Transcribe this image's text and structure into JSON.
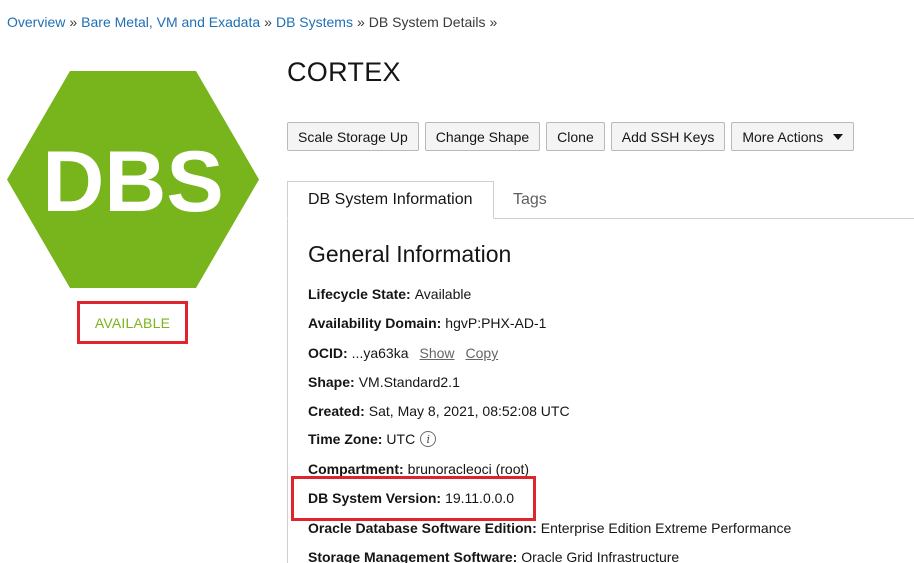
{
  "breadcrumb": {
    "items": [
      "Overview",
      "Bare Metal, VM and Exadata",
      "DB Systems"
    ],
    "current": "DB System Details",
    "separator": "»"
  },
  "badge": {
    "text": "DBS",
    "color": "#78b41c",
    "status": "AVAILABLE",
    "status_color": "#7bb31a"
  },
  "title": "CORTEX",
  "actions": {
    "scale_storage": "Scale Storage Up",
    "change_shape": "Change Shape",
    "clone": "Clone",
    "add_ssh_keys": "Add SSH Keys",
    "more_actions": "More Actions"
  },
  "tabs": {
    "info": "DB System Information",
    "tags": "Tags"
  },
  "general": {
    "heading": "General Information",
    "lifecycle": {
      "label": "Lifecycle State:",
      "value": "Available"
    },
    "availability_domain": {
      "label": "Availability Domain:",
      "value": "hgvP:PHX-AD-1"
    },
    "ocid": {
      "label": "OCID:",
      "value": "...ya63ka",
      "show": "Show",
      "copy": "Copy"
    },
    "shape": {
      "label": "Shape:",
      "value": "VM.Standard2.1"
    },
    "created": {
      "label": "Created:",
      "value": "Sat, May 8, 2021, 08:52:08 UTC"
    },
    "time_zone": {
      "label": "Time Zone:",
      "value": "UTC",
      "info_glyph": "i"
    },
    "compartment": {
      "label": "Compartment:",
      "value": "brunoracleoci (root)"
    },
    "db_version": {
      "label": "DB System Version:",
      "value": "19.11.0.0.0"
    },
    "software_edition": {
      "label": "Oracle Database Software Edition:",
      "value": "Enterprise Edition Extreme Performance"
    },
    "storage_mgmt": {
      "label": "Storage Management Software:",
      "value": "Oracle Grid Infrastructure"
    }
  },
  "highlight_color": "#e0242c"
}
